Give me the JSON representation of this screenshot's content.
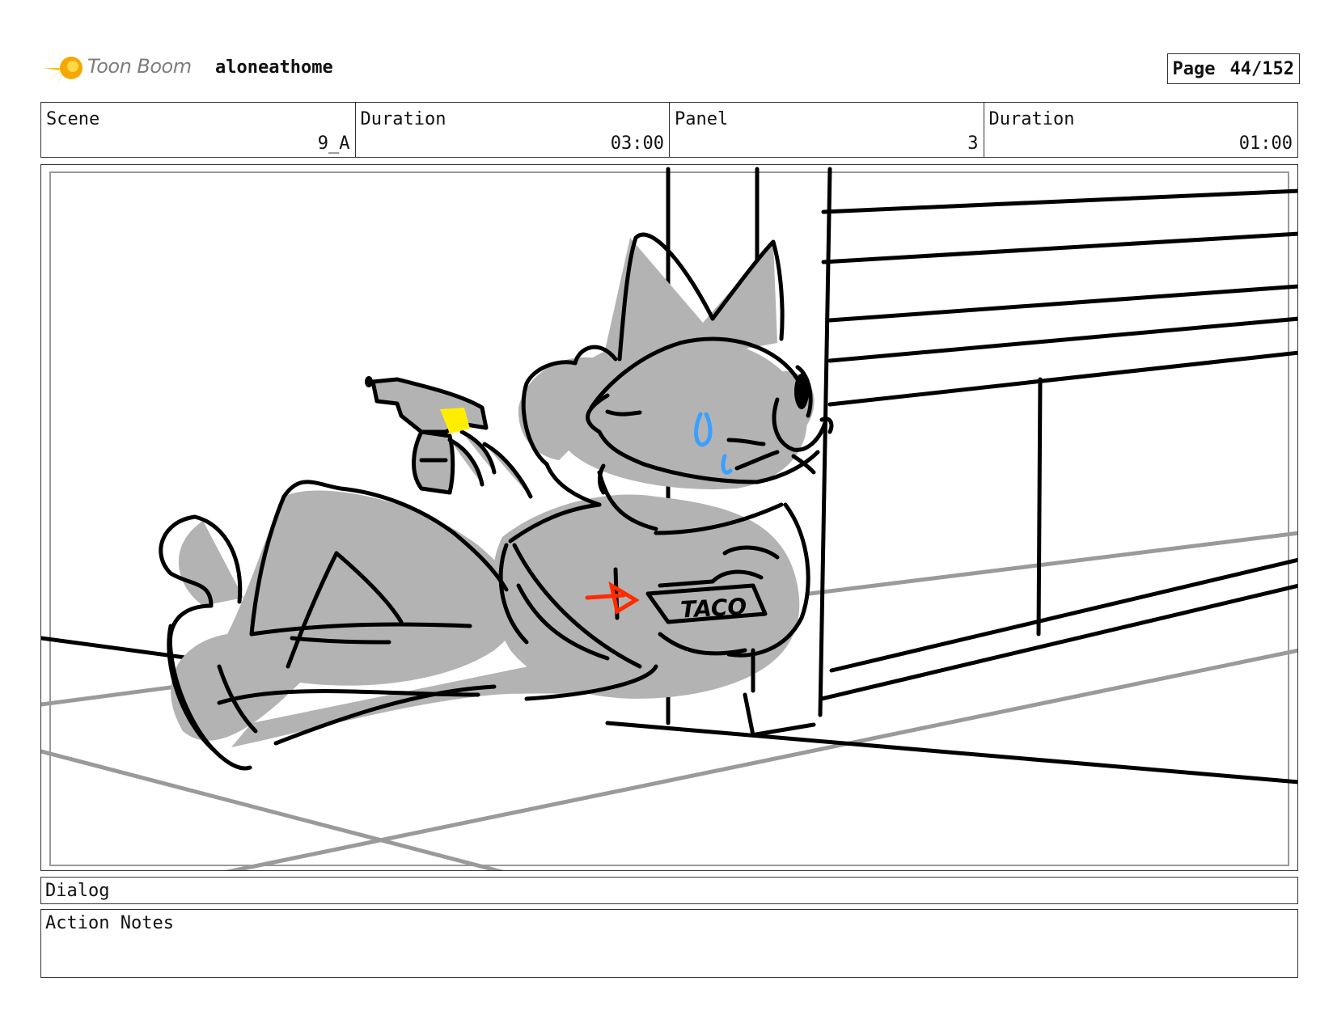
{
  "header": {
    "logo_icon": "toon-boom-burst-icon",
    "brand": "Toon Boom",
    "project": "aloneathome",
    "page_label": "Page",
    "page_value": "44/152"
  },
  "info": {
    "scene_label": "Scene",
    "scene_value": "9_A",
    "scene_duration_label": "Duration",
    "scene_duration_value": "03:00",
    "panel_label": "Panel",
    "panel_value": "3",
    "panel_duration_label": "Duration",
    "panel_duration_value": "01:00"
  },
  "panel": {
    "sign_text": "TACO",
    "colors": {
      "figure_fill": "#b3b3b3",
      "ink": "#000000",
      "floor_lines": "#9a9a9a",
      "blaster_light": "#ffee00",
      "sweat": "#3aa0ff",
      "marker": "#ff2a00"
    }
  },
  "dialog": {
    "label": "Dialog"
  },
  "notes": {
    "label": "Action Notes"
  }
}
